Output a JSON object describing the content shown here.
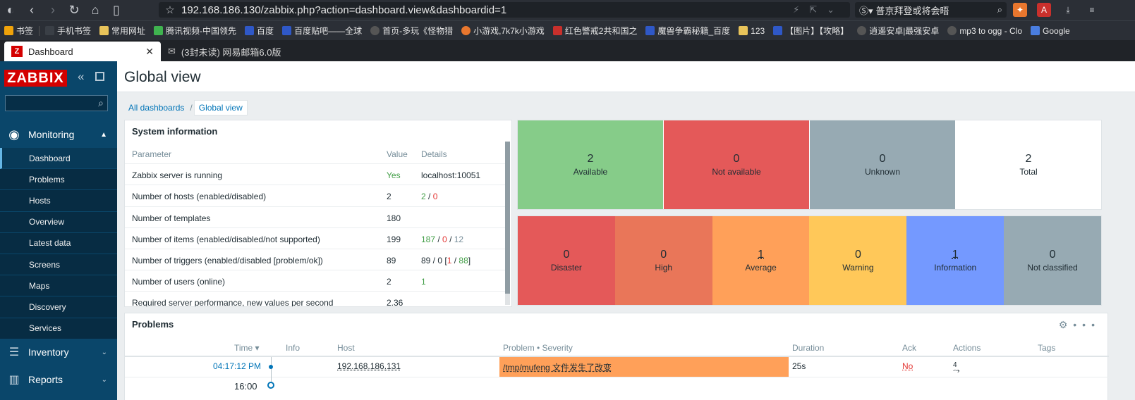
{
  "browser": {
    "url": "192.168.186.130/zabbix.php?action=dashboard.view&dashboardid=1",
    "search_text": "普京拜登或将会晤",
    "bookmarks": [
      "书签",
      "手机书签",
      "常用网址",
      "腾讯视频-中国领先",
      "百度",
      "百度贴吧——全球",
      "首页-多玩《怪物猎",
      "小游戏,7k7k小游戏",
      "红色警戒2共和国之",
      "魔兽争霸秘籍_百度",
      "123",
      "【图片】【攻略】",
      "逍遥安卓|最强安卓",
      "mp3 to ogg - Clo",
      "Google"
    ],
    "tabs": [
      {
        "label": "Dashboard",
        "favicon": "Z"
      },
      {
        "label": "(3封未读) 网易邮箱6.0版"
      }
    ]
  },
  "sidebar": {
    "logo": "ZABBIX",
    "monitoring": "Monitoring",
    "submenu": [
      "Dashboard",
      "Problems",
      "Hosts",
      "Overview",
      "Latest data",
      "Screens",
      "Maps",
      "Discovery",
      "Services"
    ],
    "inventory": "Inventory",
    "reports": "Reports"
  },
  "page": {
    "title": "Global view",
    "breadcrumb": {
      "all": "All dashboards",
      "sep": "/",
      "current": "Global view"
    }
  },
  "sysinfo": {
    "title": "System information",
    "headers": {
      "param": "Parameter",
      "value": "Value",
      "details": "Details"
    },
    "rows": [
      {
        "param": "Zabbix server is running",
        "value": "Yes",
        "details": "localhost:10051"
      },
      {
        "param": "Number of hosts (enabled/disabled)",
        "value": "2",
        "d1": "2",
        "d2": "0"
      },
      {
        "param": "Number of templates",
        "value": "180"
      },
      {
        "param": "Number of items (enabled/disabled/not supported)",
        "value": "199",
        "d1": "187",
        "d2": "0",
        "d3": "12"
      },
      {
        "param": "Number of triggers (enabled/disabled [problem/ok])",
        "value": "89",
        "d0": "89 / 0 [",
        "d1": "1",
        "d2": "88",
        "d3": "]"
      },
      {
        "param": "Number of users (online)",
        "value": "2",
        "d1": "1"
      },
      {
        "param": "Required server performance, new values per second",
        "value": "2.36"
      }
    ]
  },
  "host_availability": [
    {
      "count": "2",
      "label": "Available",
      "color": "#86cc89"
    },
    {
      "count": "0",
      "label": "Not available",
      "color": "#e45959"
    },
    {
      "count": "0",
      "label": "Unknown",
      "color": "#97aab3"
    },
    {
      "count": "2",
      "label": "Total",
      "color": "#ffffff"
    }
  ],
  "problems_by_severity": [
    {
      "count": "0",
      "label": "Disaster",
      "color": "#e45959"
    },
    {
      "count": "0",
      "label": "High",
      "color": "#e97659"
    },
    {
      "count": "1",
      "label": "Average",
      "color": "#ffa059"
    },
    {
      "count": "0",
      "label": "Warning",
      "color": "#ffc859"
    },
    {
      "count": "1",
      "label": "Information",
      "color": "#7499ff"
    },
    {
      "count": "0",
      "label": "Not classified",
      "color": "#97aab3"
    }
  ],
  "problems": {
    "title": "Problems",
    "headers": {
      "time": "Time ▾",
      "info": "Info",
      "host": "Host",
      "problem": "Problem • Severity",
      "duration": "Duration",
      "ack": "Ack",
      "actions": "Actions",
      "tags": "Tags"
    },
    "row": {
      "time": "04:17:12 PM",
      "host": "192.168.186.131",
      "problem": "/tmp/mufeng 文件发生了改变",
      "duration": "25s",
      "ack": "No",
      "actions": "4"
    },
    "hour_marker": "16:00"
  },
  "colors": {
    "sidebar": "#0a466a",
    "accent_link": "#0275b8",
    "logo": "#d40000"
  }
}
